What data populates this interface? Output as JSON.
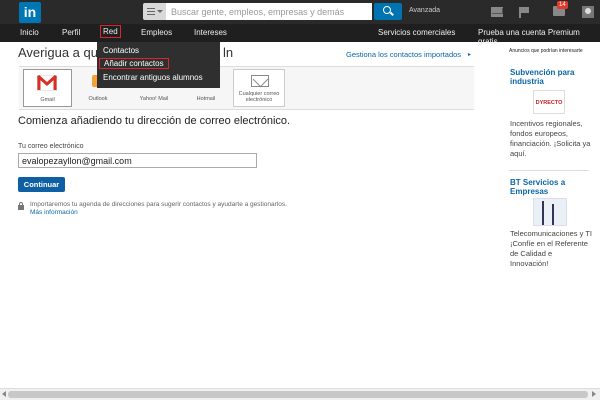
{
  "topbar": {
    "logo": "in",
    "search_placeholder": "Buscar gente, empleos, empresas y demás",
    "advanced": "Avanzada",
    "notifications_count": "14",
    "icons": [
      "linkedin-logo",
      "menu-icon",
      "search-icon",
      "mail-icon",
      "flag-icon",
      "notifications-icon",
      "user-icon"
    ]
  },
  "nav": {
    "items": [
      "Inicio",
      "Perfil",
      "Red",
      "Empleos",
      "Intereses"
    ],
    "right_items": [
      "Servicios comerciales",
      "Prueba una cuenta Premium gratis"
    ]
  },
  "dropdown": {
    "items": [
      "Contactos",
      "Añadir contactos",
      "Encontrar antiguos alumnos"
    ]
  },
  "main": {
    "heading_start": "Averigua a qui",
    "heading_end": "ln",
    "manage_link": "Gestiona los contactos importados",
    "providers": [
      "Gmail",
      "Outlook",
      "Yahoo! Mail",
      "Hotmail",
      "Cualquier correo electrónico"
    ],
    "subtitle": "Comienza añadiendo tu dirección de correo electrónico.",
    "email_label": "Tu correo electrónico",
    "email_value": "evalopezayllon@gmail.com",
    "continue_label": "Continuar",
    "privacy_text": "Importaremos tu agenda de direcciones para sugerir contactos y ayudarte a gestionarlos.",
    "more_info": "Más información"
  },
  "sidebar": {
    "ads_label": "Anuncios que podrían interesarte",
    "ad1": {
      "title": "Subvención para industria",
      "logo": "DYRECTO",
      "text": "Incentivos regionales, fondos europeos, financiación. ¡Solicita ya aquí."
    },
    "ad2": {
      "title": "BT Servicios a Empresas",
      "text": "Telecomunicaciones y TI ¡Confíe en el Referente de Calidad e Innovación!"
    }
  },
  "colors": {
    "topbar": "#2a2a2a",
    "navbar": "#1f1f1f",
    "accent": "#0073b1",
    "highlight": "#d9262c",
    "link": "#0a66a8"
  }
}
